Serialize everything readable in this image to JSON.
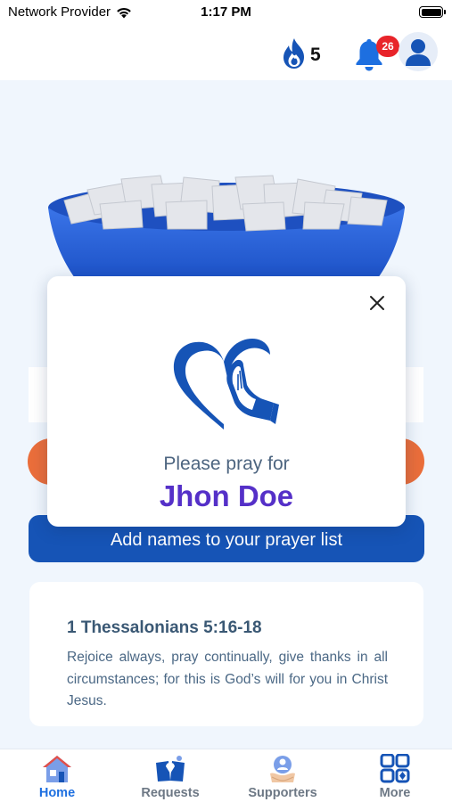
{
  "status_bar": {
    "carrier": "Network Provider",
    "time": "1:17 PM"
  },
  "header": {
    "streak_count": "5",
    "notification_count": "26"
  },
  "modal": {
    "label": "Please pray for",
    "name": "Jhon Doe"
  },
  "main": {
    "add_names_label": "Add names to your prayer list"
  },
  "verse": {
    "reference": "1 Thessalonians 5:16-18",
    "text": "Rejoice always, pray continually, give thanks in all circumstances; for this is God’s will for you in Christ Jesus."
  },
  "bottom_nav": {
    "items": [
      {
        "label": "Home",
        "icon": "home-icon",
        "active": true
      },
      {
        "label": "Requests",
        "icon": "prayer-book-icon",
        "active": false
      },
      {
        "label": "Supporters",
        "icon": "supporters-icon",
        "active": false
      },
      {
        "label": "More",
        "icon": "grid-icon",
        "active": false
      }
    ]
  },
  "colors": {
    "primary": "#1654b6",
    "name_accent": "#5530c8",
    "accent_orange": "#ea6e3b",
    "badge_red": "#e8242a",
    "nav_active": "#1d6fe0",
    "background": "#f0f6fd"
  }
}
